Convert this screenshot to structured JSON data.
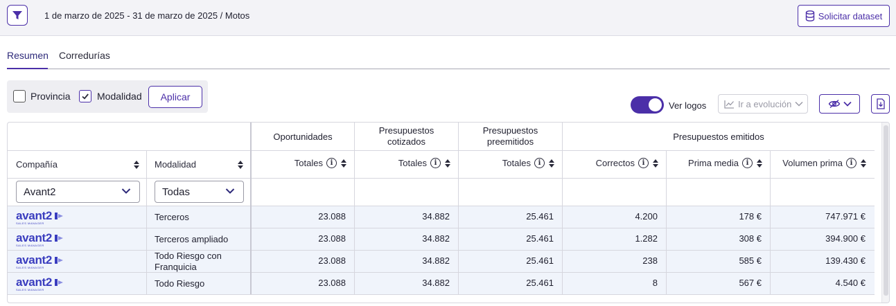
{
  "topbar": {
    "filter_icon": "funnel-icon",
    "breadcrumb": "1 de marzo de 2025 - 31 de marzo de 2025 / Motos",
    "dataset_button": "Solicitar dataset",
    "dataset_icon": "database-icon"
  },
  "tabs": [
    {
      "label": "Resumen",
      "active": true
    },
    {
      "label": "Corredurías",
      "active": false
    }
  ],
  "options": {
    "provincia": {
      "label": "Provincia",
      "checked": false
    },
    "modalidad": {
      "label": "Modalidad",
      "checked": true
    },
    "apply_label": "Aplicar"
  },
  "toolbar": {
    "logos_toggle_on": true,
    "logos_label": "Ver logos",
    "evolution_label": "Ir a evolución",
    "evolution_icon": "line-chart-icon",
    "visibility_icon": "eye-off-icon",
    "download_icon": "file-download-icon"
  },
  "table": {
    "group_headers": {
      "oportunidades": "Oportunidades",
      "cotizados_1": "Presupuestos",
      "cotizados_2": "cotizados",
      "preemitidos_1": "Presupuestos",
      "preemitidos_2": "preemitidos",
      "emitidos": "Presupuestos emitidos"
    },
    "columns": {
      "compania": "Compañía",
      "modalidad": "Modalidad",
      "op_totales": "Totales",
      "cot_totales": "Totales",
      "pre_totales": "Totales",
      "correctos": "Correctos",
      "prima_media": "Prima media",
      "volumen_prima": "Volumen prima"
    },
    "filters": {
      "compania": "Avant2",
      "modalidad": "Todas"
    },
    "logo": {
      "word": "avant2",
      "sub": "SALES MANAGER"
    },
    "rows": [
      {
        "modalidad": "Terceros",
        "op": "23.088",
        "cot": "34.882",
        "pre": "25.461",
        "correctos": "4.200",
        "prima": "178 €",
        "volumen": "747.971 €"
      },
      {
        "modalidad": "Terceros ampliado",
        "op": "23.088",
        "cot": "34.882",
        "pre": "25.461",
        "correctos": "1.282",
        "prima": "308 €",
        "volumen": "394.900 €"
      },
      {
        "modalidad_1": "Todo Riesgo con",
        "modalidad_2": "Franquicia",
        "op": "23.088",
        "cot": "34.882",
        "pre": "25.461",
        "correctos": "238",
        "prima": "585 €",
        "volumen": "139.430 €"
      },
      {
        "modalidad": "Todo Riesgo",
        "op": "23.088",
        "cot": "34.882",
        "pre": "25.461",
        "correctos": "8",
        "prima": "567 €",
        "volumen": "4.540 €"
      }
    ]
  },
  "colors": {
    "accent": "#4b2fa8",
    "logo_blue": "#3a3dbf",
    "row_bg": "#f0f4fb",
    "topbar_bg": "#f3f3f7"
  }
}
